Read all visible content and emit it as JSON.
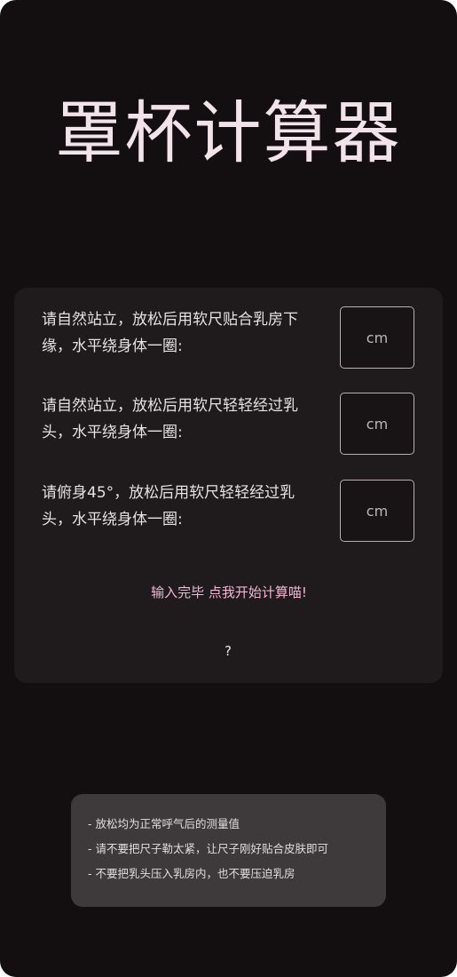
{
  "title": "罩杯计算器",
  "questions": [
    {
      "text": "请自然站立，放松后用软尺贴合乳房下缘，水平绕身体一圈:",
      "placeholder": "cm",
      "value": ""
    },
    {
      "text": "请自然站立，放松后用软尺轻轻经过乳头，水平绕身体一圈:",
      "placeholder": "cm",
      "value": ""
    },
    {
      "text": "请俯身45°，放松后用软尺轻轻经过乳头，水平绕身体一圈:",
      "placeholder": "cm",
      "value": ""
    }
  ],
  "calculate_label": "输入完毕 点我开始计算喵!",
  "help_label": "?",
  "notes": [
    "- 放松均为正常呼气后的测量值",
    "- 请不要把尺子勒太紧，让尺子刚好贴合皮肤即可",
    "- 不要把乳头压入乳房内，也不要压迫乳房"
  ],
  "colors": {
    "background": "#130e10",
    "card": "#1f1a1c",
    "accent": "#f1b8d4",
    "notes_panel": "#3e3a3b"
  }
}
